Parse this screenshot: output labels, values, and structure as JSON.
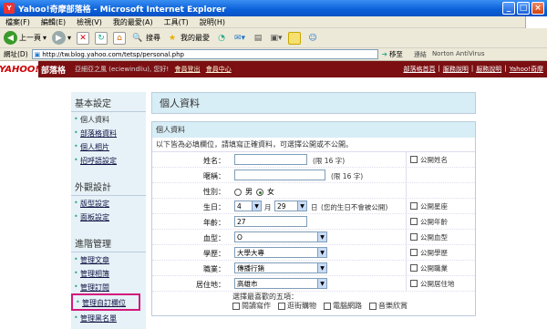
{
  "window": {
    "title": "Yahoo!奇摩部落格 - Microsoft Internet Explorer"
  },
  "menu": [
    "檔案(F)",
    "編輯(E)",
    "檢視(V)",
    "我的最愛(A)",
    "工具(T)",
    "說明(H)"
  ],
  "toolbar": {
    "back": "上一頁",
    "search": "搜尋",
    "favorites": "我的最愛"
  },
  "address": {
    "label": "網址(D)",
    "url": "http://tw.blog.yahoo.com/tetsp/personal.php",
    "go": "移至",
    "links": "連結",
    "norton": "Norton AntiVirus"
  },
  "ybar": {
    "logo": "YAHOO!",
    "blog": "部落格",
    "user": "亞細亞之風 (eciewindliu), 您好!",
    "logout": "會員登出",
    "center": "會員中心",
    "right": [
      "部落格首頁",
      "服務說明",
      "服務說明",
      "Yahoo!奇摩"
    ]
  },
  "sidebar": {
    "sections": [
      {
        "title": "基本設定",
        "items": [
          {
            "label": "個人資料",
            "plain": true
          },
          {
            "label": "部落格資料"
          },
          {
            "label": "個人相片"
          },
          {
            "label": "招呼語設定"
          }
        ]
      },
      {
        "title": "外觀設計",
        "items": [
          {
            "label": "版型設定"
          },
          {
            "label": "面板設定"
          }
        ]
      },
      {
        "title": "進階管理",
        "items": [
          {
            "label": "管理文章"
          },
          {
            "label": "管理相簿"
          },
          {
            "label": "管理訂閱"
          },
          {
            "label": "管理自訂欄位",
            "active": true
          },
          {
            "label": "管理黑名單"
          }
        ]
      }
    ]
  },
  "main": {
    "title": "個人資料",
    "subtitle": "個人資料",
    "desc": "以下皆為必填欄位，請填寫正確資料，可選擇公開或不公開。",
    "fields": [
      {
        "label": "姓名：",
        "value": "",
        "note": "(限 16 字)",
        "pub": "公開姓名"
      },
      {
        "label": "暱稱：",
        "value": "",
        "note": "(限 16 字)",
        "pub": ""
      },
      {
        "label": "性別：",
        "male": "男",
        "female": "女",
        "pub": ""
      },
      {
        "label": "生日：",
        "month": "4",
        "month_unit": "月",
        "day": "29",
        "day_unit": "日",
        "note": "(您的生日不會被公開)",
        "pub": "公開星座"
      },
      {
        "label": "年齡：",
        "value": "27",
        "pub": "公開年齡"
      },
      {
        "label": "血型：",
        "value": "O",
        "pub": "公開血型"
      },
      {
        "label": "學歷：",
        "value": "大學大專",
        "pub": "公開學歷"
      },
      {
        "label": "職業：",
        "value": "傳播行銷",
        "pub": "公開職業"
      },
      {
        "label": "居住地：",
        "value": "高雄市",
        "pub": "公開居住地"
      }
    ],
    "pref_title": "選擇最喜歡的五項：",
    "prefs": [
      "閱讀寫作",
      "逛街購物",
      "電腦網路",
      "音樂欣賞"
    ]
  }
}
